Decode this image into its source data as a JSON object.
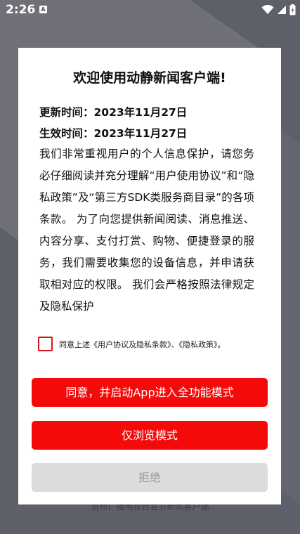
{
  "status_bar": {
    "time": "2:26",
    "notification_icon": "A"
  },
  "background": {
    "footer_text": "贵州广播电视台官方新闻客户端"
  },
  "dialog": {
    "title": "欢迎使用动静新闻客户端!",
    "update_time": "更新时间：2023年11月27日",
    "effective_time": "生效时间：2023年11月27日",
    "body": "我们非常重视用户的个人信息保护，请您务必仔细阅读并充分理解“用户使用协议”和“隐私政策”及“第三方SDK类服务商目录”的各项条款。 为了向您提供新闻阅读、消息推送、内容分享、支付打赏、购物、便捷登录的服务，我们需要收集您的设备信息，并申请获取相对应的权限。 我们会严格按照法律规定及隐私保护",
    "agree_label": "同意上述《用户协议及隐私条款》、《隐私政策》。",
    "agree_checked": false,
    "buttons": {
      "agree": "同意，并启动App进入全功能模式",
      "browse": "仅浏览模式",
      "refuse": "拒绝"
    }
  },
  "colors": {
    "accent": "#f50a0a",
    "checkbox_border": "#d9131b",
    "disabled_bg": "#dcdcdc",
    "overlay": "#5d6069"
  }
}
